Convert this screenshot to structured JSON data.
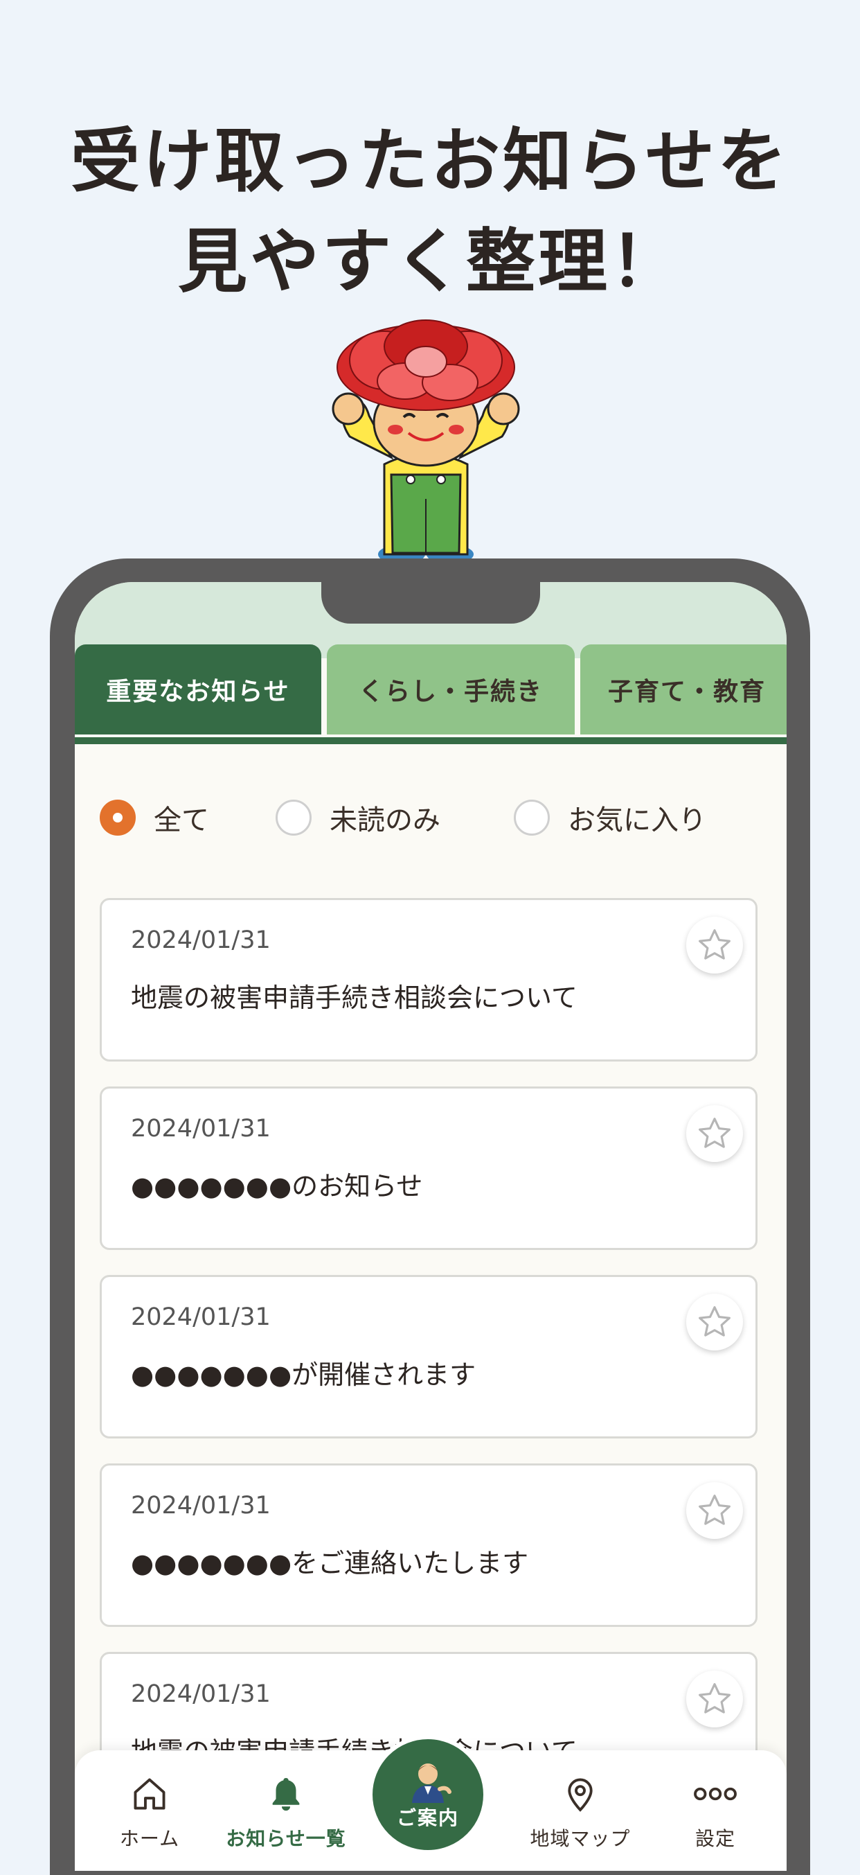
{
  "headline": {
    "line1": "受け取ったお知らせを",
    "line2": "見やすく整理！"
  },
  "tabs": [
    {
      "label": "重要なお知らせ",
      "active": true
    },
    {
      "label": "くらし・手続き",
      "active": false
    },
    {
      "label": "子育て・教育",
      "active": false
    }
  ],
  "filters": [
    {
      "label": "全て",
      "checked": true
    },
    {
      "label": "未読のみ",
      "checked": false
    },
    {
      "label": "お気に入り",
      "checked": false
    }
  ],
  "notices": [
    {
      "date": "2024/01/31",
      "title": "地震の被害申請手続き相談会について"
    },
    {
      "date": "2024/01/31",
      "title": "●●●●●●●のお知らせ"
    },
    {
      "date": "2024/01/31",
      "title": "●●●●●●●が開催されます"
    },
    {
      "date": "2024/01/31",
      "title": "●●●●●●●をご連絡いたします"
    },
    {
      "date": "2024/01/31",
      "title": "地震の被害申請手続き相談会について"
    }
  ],
  "bottom_nav": {
    "home": "ホーム",
    "notices": "お知らせ一覧",
    "guide": "ご案内",
    "map": "地域マップ",
    "settings": "設定"
  },
  "colors": {
    "accent_green": "#356b45",
    "light_green": "#90c389",
    "radio_orange": "#e3722c",
    "background": "#eef4fa"
  },
  "icons": [
    "home-icon",
    "bell-icon",
    "guide-person-icon",
    "map-pin-icon",
    "more-dots-icon",
    "star-icon",
    "mascot-carnation"
  ]
}
